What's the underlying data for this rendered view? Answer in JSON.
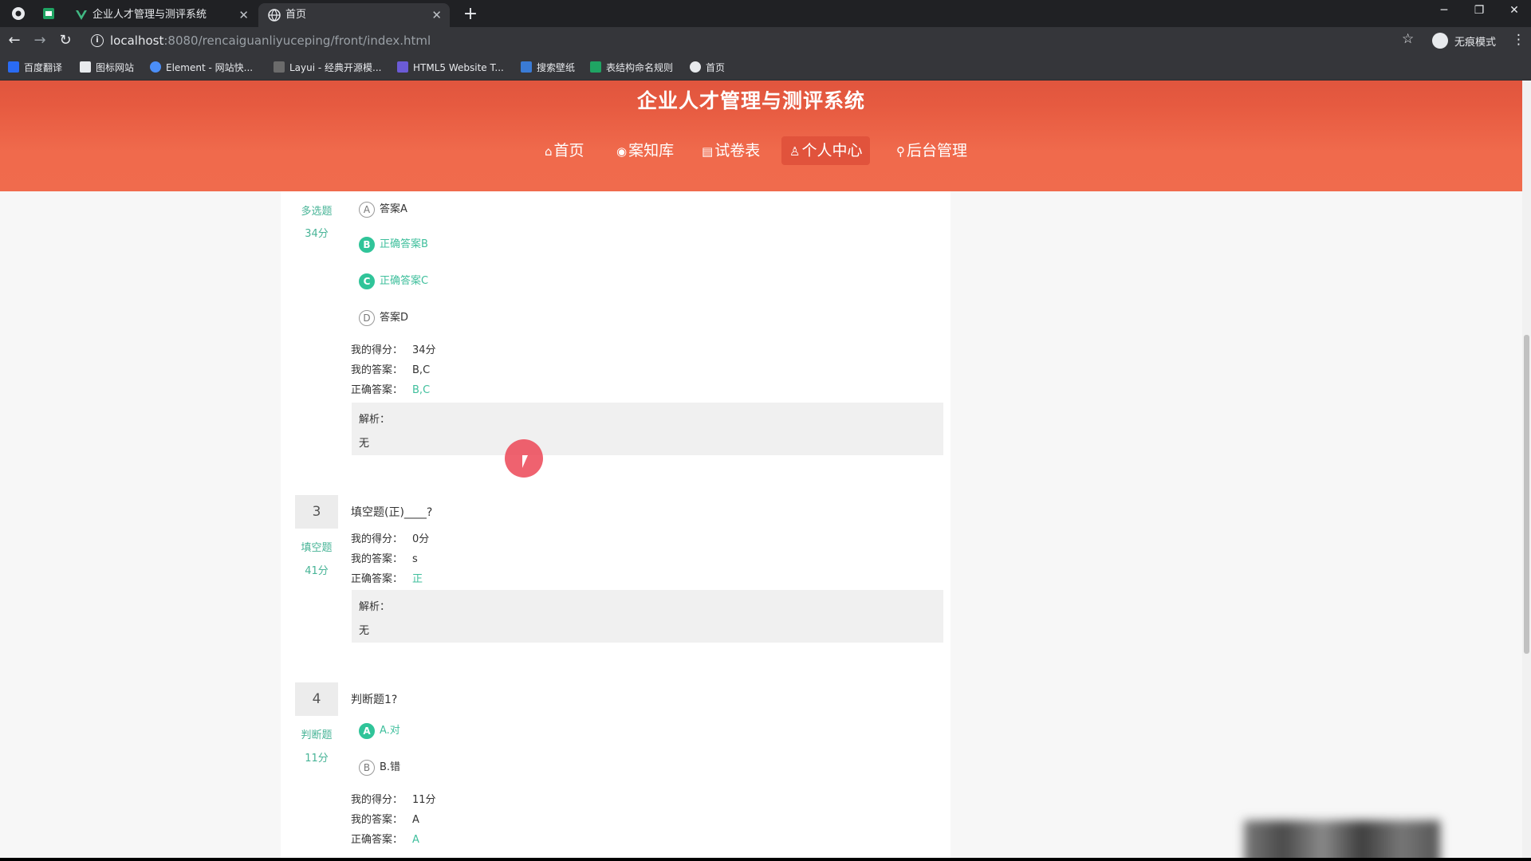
{
  "browser": {
    "tabs": [
      {
        "label": "企业人才管理与测评系统",
        "active": false
      },
      {
        "label": "首页",
        "active": true
      }
    ],
    "new_tab": "+",
    "url_host": "localhost",
    "url_rest": ":8080/rencaiguanliyuceping/front/index.html",
    "incognito_label": "无痕模式",
    "bookmarks": [
      "百度翻译",
      "图标网站",
      "Element - 网站快...",
      "Layui - 经典开源模...",
      "HTML5 Website T...",
      "搜索壁纸",
      "表结构命名规则",
      "首页"
    ]
  },
  "site": {
    "title": "企业人才管理与测评系统",
    "nav": [
      {
        "icon": "⌂",
        "label": "首页"
      },
      {
        "icon": "◉",
        "label": "案知库"
      },
      {
        "icon": "▤",
        "label": "试卷表"
      },
      {
        "icon": "♙",
        "label": "个人中心",
        "active": true
      },
      {
        "icon": "⚲",
        "label": "后台管理"
      }
    ]
  },
  "labels": {
    "my_score": "我的得分：",
    "my_answer": "我的答案：",
    "correct_answer": "正确答案：",
    "analysis": "解析："
  },
  "questions": [
    {
      "type": "多选题",
      "score": "34分",
      "options": [
        {
          "letter": "A",
          "text": "答案A",
          "correct": false
        },
        {
          "letter": "B",
          "text": "正确答案B",
          "correct": true
        },
        {
          "letter": "C",
          "text": "正确答案C",
          "correct": true
        },
        {
          "letter": "D",
          "text": "答案D",
          "correct": false
        }
      ],
      "my_score": "34分",
      "my_answer": "B,C",
      "correct_answer": "B,C",
      "analysis": "无"
    },
    {
      "number": "3",
      "type": "填空题",
      "score": "41分",
      "title": "填空题(正)____?",
      "my_score": "0分",
      "my_answer": "s",
      "correct_answer": "正",
      "analysis": "无"
    },
    {
      "number": "4",
      "type": "判断题",
      "score": "11分",
      "title": "判断题1?",
      "options": [
        {
          "letter": "A",
          "text": "A.对",
          "correct": true
        },
        {
          "letter": "B",
          "text": "B.错",
          "correct": false
        }
      ],
      "my_score": "11分",
      "my_answer": "A",
      "correct_answer": "A"
    }
  ],
  "colors": {
    "header": "#f06a4c",
    "accent_green": "#3fbf9c",
    "cursor_highlight": "#ec4656"
  }
}
